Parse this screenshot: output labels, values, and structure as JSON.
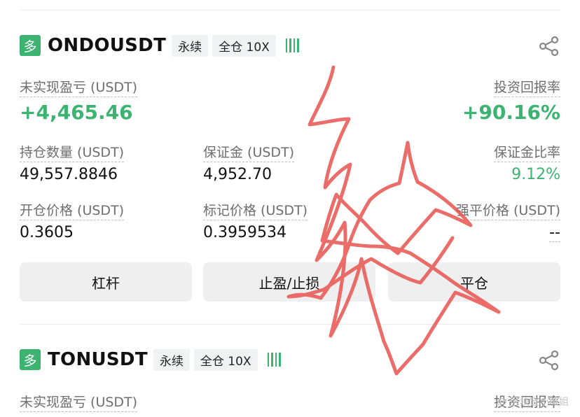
{
  "positions": [
    {
      "side": "多",
      "symbol": "ONDOUSDT",
      "type_tag": "永续",
      "margin_tag": "全仓 10X",
      "unrealized_pnl_label": "未实现盈亏 (USDT)",
      "unrealized_pnl": "+4,465.46",
      "roi_label": "投资回报率",
      "roi": "+90.16%",
      "size_label": "持仓数量 (USDT)",
      "size": "49,557.8846",
      "margin_label": "保证金 (USDT)",
      "margin": "4,952.70",
      "margin_ratio_label": "保证金比率",
      "margin_ratio": "9.12%",
      "entry_price_label": "开仓价格 (USDT)",
      "entry_price": "0.3605",
      "mark_price_label": "标记价格 (USDT)",
      "mark_price": "0.3959534",
      "liq_price_label": "强平价格 (USDT)",
      "liq_price": "--",
      "buttons": {
        "leverage": "杠杆",
        "tp_sl": "止盈/止损",
        "close": "平仓"
      }
    },
    {
      "side": "多",
      "symbol": "TONUSDT",
      "type_tag": "永续",
      "margin_tag": "全仓 10X",
      "unrealized_pnl_label": "未实现盈亏 (USDT)",
      "roi_label": "投资回报率"
    }
  ],
  "icons": {
    "share": "share-icon",
    "leverage_indicator": "leverage-bars-icon"
  },
  "colors": {
    "green": "#3cb371",
    "scribble": "#e8534f"
  },
  "watermark": "@ 区块链小敏姐"
}
